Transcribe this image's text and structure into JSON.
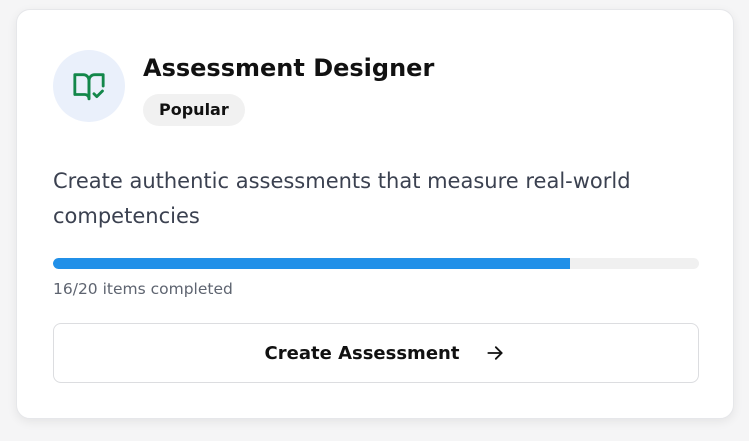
{
  "card": {
    "title": "Assessment Designer",
    "badge": "Popular",
    "description": "Create authentic assessments that measure real-world competencies",
    "icon": "book-check-icon",
    "icon_color": "#13874a",
    "icon_bg": "#eaf0fb"
  },
  "progress": {
    "completed": 16,
    "total": 20,
    "fraction": 0.8,
    "text": "16/20 items completed",
    "color": "#2190e8"
  },
  "cta": {
    "label": "Create Assessment",
    "icon": "arrow-right-icon"
  }
}
